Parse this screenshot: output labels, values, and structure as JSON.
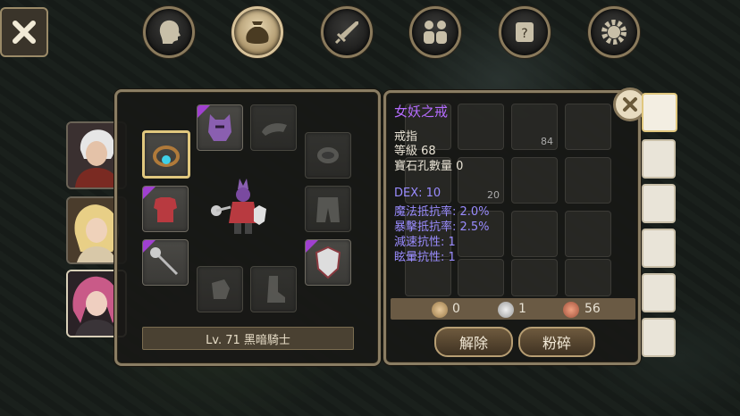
{
  "top_nav": {
    "icons": [
      "head-profile-icon",
      "bag-icon",
      "sword-icon",
      "party-icon",
      "quest-scroll-icon",
      "gear-icon"
    ],
    "active": 1
  },
  "equipment": {
    "level_label": "Lv. 71 黑暗騎士"
  },
  "item": {
    "name": "女妖之戒",
    "name_color": "#b56cff",
    "type": "戒指",
    "level": "等級 68",
    "gem_slots": "寶石孔數量 0",
    "stats": [
      "DEX: 10",
      "魔法抵抗率: 2.0%",
      "暴擊抵抗率: 2.5%",
      "減速抗性: 1",
      "眩暈抗性: 1"
    ],
    "stat_color": "#9a8cff"
  },
  "currency": {
    "gold": "0",
    "silver": "1",
    "bronze": "56"
  },
  "actions": {
    "unequip": "解除",
    "smash": "粉碎"
  },
  "inventory_counts": [
    "84",
    "20"
  ]
}
